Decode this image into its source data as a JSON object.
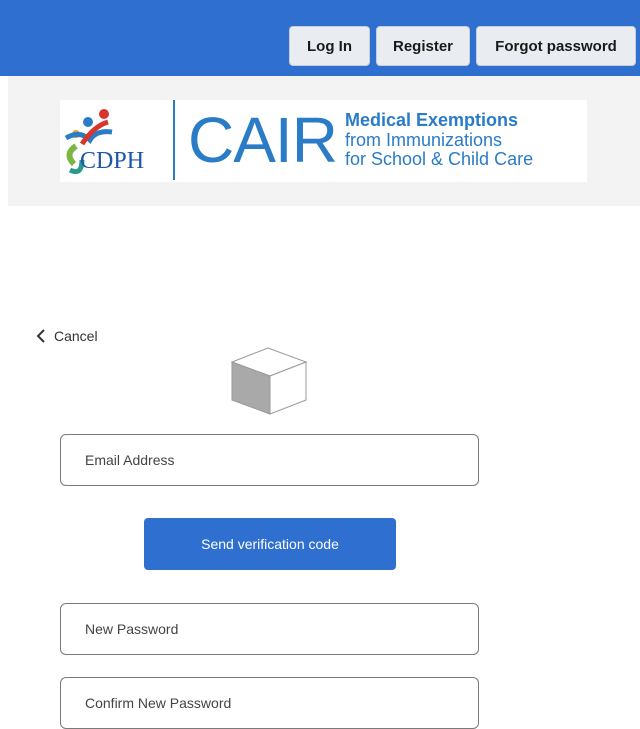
{
  "nav": {
    "login_label": "Log In",
    "register_label": "Register",
    "forgot_label": "Forgot password"
  },
  "banner": {
    "cair": "CAIR",
    "cdph": "CDPH",
    "title": "Medical Exemptions",
    "line1": "from Immunizations",
    "line2": "for School & Child Care",
    "brand_color": "#2a7cc7"
  },
  "form": {
    "cancel_label": "Cancel",
    "email_placeholder": "Email Address",
    "send_code_label": "Send verification code",
    "new_password_placeholder": "New Password",
    "confirm_password_placeholder": "Confirm New Password",
    "accent_color": "#2f6fd0"
  },
  "icons": {
    "back": "chevron-left-icon",
    "cube": "cube-icon"
  }
}
